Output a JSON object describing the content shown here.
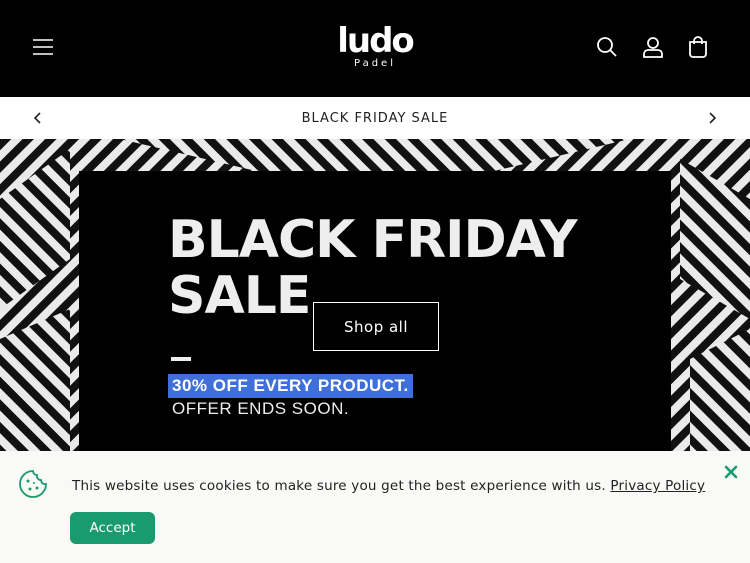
{
  "header": {
    "logo_text": "ludo",
    "logo_sub": "Padel",
    "menu_icon": "hamburger-menu-icon",
    "search_icon": "search-icon",
    "account_icon": "account-icon",
    "cart_icon": "cart-icon"
  },
  "announcement": {
    "text": "BLACK FRIDAY SALE",
    "prev_icon": "chevron-left-icon",
    "next_icon": "chevron-right-icon"
  },
  "hero": {
    "title_line1": "BLACK FRIDAY",
    "title_line2": "SALE",
    "highlight": "30% OFF EVERY PRODUCT.",
    "subtext": "OFFER ENDS SOON.",
    "cta_label": "Shop all"
  },
  "cookie_banner": {
    "message": "This website uses cookies to make sure you get the best experience with us. ",
    "link_label": "Privacy Policy",
    "accept_label": "Accept",
    "close_icon": "close-icon",
    "cookie_icon": "cookie-icon"
  },
  "colors": {
    "header_bg": "#000000",
    "accept_green": "#1a9b6f",
    "highlight_blue": "#3f6fd8",
    "close_green": "#1a9b6f"
  }
}
